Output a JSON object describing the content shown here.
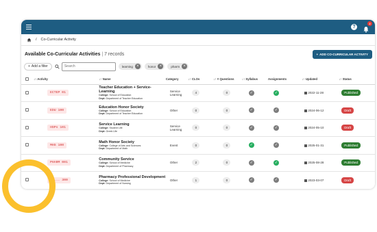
{
  "topbar": {
    "menu_icon": "hamburger-icon",
    "help_icon": "help-icon",
    "help_glyph": "?",
    "bell_icon": "bell-icon",
    "notification_count": "2",
    "color": "#1e5d82"
  },
  "breadcrumb": {
    "home_icon": "home-icon",
    "separator": "/",
    "current": "Co-Curricular Activity"
  },
  "header": {
    "title": "Available Co-Curricular Activities",
    "separator": "|",
    "count": "7 records",
    "add_button": "ADD CO-CURRICULAR ACTIVITY"
  },
  "filters": {
    "add_filter": "Add a filter",
    "search_placeholder": "Search",
    "chips": [
      "learning",
      "honor",
      "pharm"
    ]
  },
  "table": {
    "columns": [
      "Activity",
      "Name",
      "Category",
      "CLOs",
      "# Questions",
      "Syllabus",
      "Assignments",
      "Updated",
      "Status"
    ],
    "rows": [
      {
        "code": "ECTEP 01",
        "name": "Teacher Education + Service-Learning",
        "college": "School of Education",
        "dept": "Department of Teacher Education",
        "category": "Service Learning",
        "clos": "4",
        "questions": "0",
        "syllabus": "gray",
        "assignments": "green",
        "updated": "2022-11-28",
        "status": "Published"
      },
      {
        "code": "EDU 100",
        "name": "Education Honor Society",
        "college": "School of Education",
        "dept": "Department of Teacher Education",
        "category": "Other",
        "clos": "0",
        "questions": "0",
        "syllabus": "gray",
        "assignments": "gray",
        "updated": "2024-06-12",
        "status": "Draft"
      },
      {
        "code": "HSPs 101",
        "name": "Service Learning",
        "college": "Student Life",
        "dept": "Greek Life",
        "category": "Service Learning",
        "clos": "0",
        "questions": "0",
        "syllabus": "gray",
        "assignments": "gray",
        "updated": "2024-05-10",
        "status": "Draft"
      },
      {
        "code": "MHS 100",
        "name": "Math Honor Society",
        "college": "College of Arts and Sciences",
        "dept": "Department of Math",
        "category": "Event",
        "clos": "0",
        "questions": "0",
        "syllabus": "green",
        "assignments": "gray",
        "updated": "2025-01-31",
        "status": "Published"
      },
      {
        "code": "PHARM 001",
        "name": "Community Service",
        "college": "School of Medicine",
        "dept": "Department of Pharmacy",
        "category": "Other",
        "clos": "2",
        "questions": "0",
        "syllabus": "gray",
        "assignments": "green",
        "updated": "2025-08-28",
        "status": "Published"
      },
      {
        "code": "PH... 300",
        "name": "Pharmacy Professional Development",
        "college": "School of Medicine",
        "dept": "Department of Nursing",
        "category": "Other",
        "clos": "1",
        "questions": "0",
        "syllabus": "gray",
        "assignments": "gray",
        "updated": "2023-03-07",
        "status": "Draft"
      }
    ]
  },
  "labels": {
    "college_prefix": "College:",
    "dept_prefix": "Dept:",
    "sort_glyph": "↓↑"
  },
  "colors": {
    "accent": "#1e5d82",
    "published": "#2e7d32",
    "draft": "#d64545",
    "code_badge": "#d32f2f",
    "highlight_ring": "#fbc02d"
  }
}
